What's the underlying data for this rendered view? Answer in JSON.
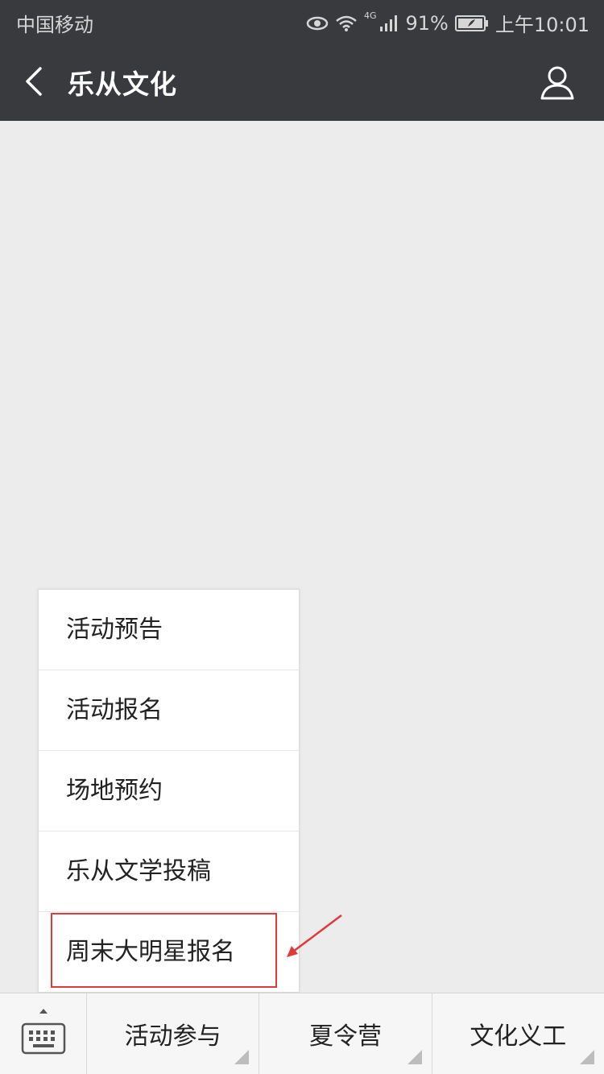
{
  "status_bar": {
    "carrier": "中国移动",
    "network": "4G",
    "battery": "91%",
    "time": "上午10:01",
    "icons": [
      "eye-icon",
      "wifi-icon",
      "signal-icon",
      "battery-icon"
    ]
  },
  "header": {
    "title": "乐从文化",
    "back_icon": "chevron-left-icon",
    "profile_icon": "person-icon"
  },
  "menu": {
    "items": [
      {
        "label": "活动预告"
      },
      {
        "label": "活动报名"
      },
      {
        "label": "场地预约"
      },
      {
        "label": "乐从文学投稿"
      },
      {
        "label": "周末大明星报名"
      }
    ],
    "highlighted_index": 4,
    "highlight_color": "#e23a3a"
  },
  "bottom_bar": {
    "keyboard_icon": "keyboard-icon",
    "tabs": [
      {
        "label": "活动参与"
      },
      {
        "label": "夏令营"
      },
      {
        "label": "文化义工"
      }
    ]
  }
}
